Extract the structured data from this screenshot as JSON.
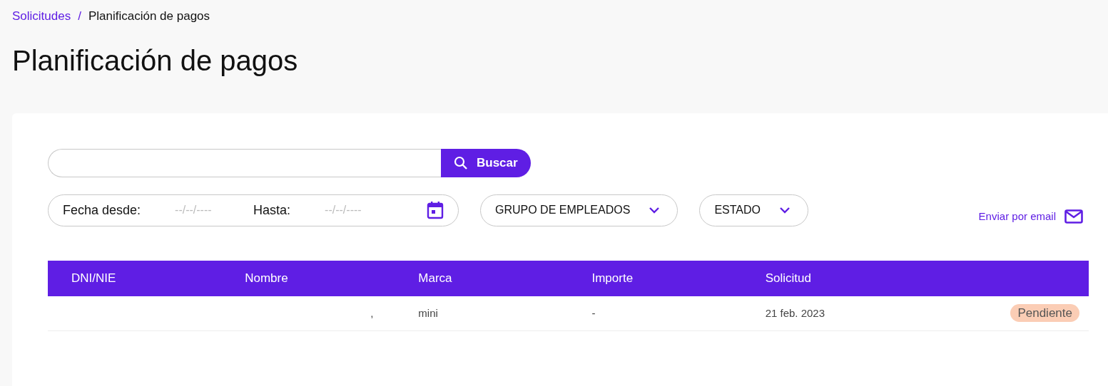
{
  "breadcrumb": [
    {
      "label": "Solicitudes",
      "link": true
    },
    {
      "label": "Planificación de pagos",
      "link": false
    }
  ],
  "breadcrumb_separator": "/",
  "title": "Planificación de pagos",
  "search": {
    "button": "Buscar"
  },
  "date_filter": {
    "from_label": "Fecha desde:",
    "from_placeholder": "--/--/----",
    "to_label": "Hasta:",
    "to_placeholder": "--/--/----"
  },
  "dropdowns": [
    "GRUPO DE EMPLEADOS",
    "ESTADO"
  ],
  "email_link": "Enviar por email",
  "table": {
    "columns": [
      "DNI/NIE",
      "Nombre",
      "Marca",
      "Importe",
      "Solicitud"
    ],
    "rows": [
      {
        "cells": [
          "",
          ",",
          "mini",
          "-",
          "21 feb. 2023"
        ],
        "status": "Pendiente",
        "color": "#fbcdb5"
      }
    ]
  }
}
